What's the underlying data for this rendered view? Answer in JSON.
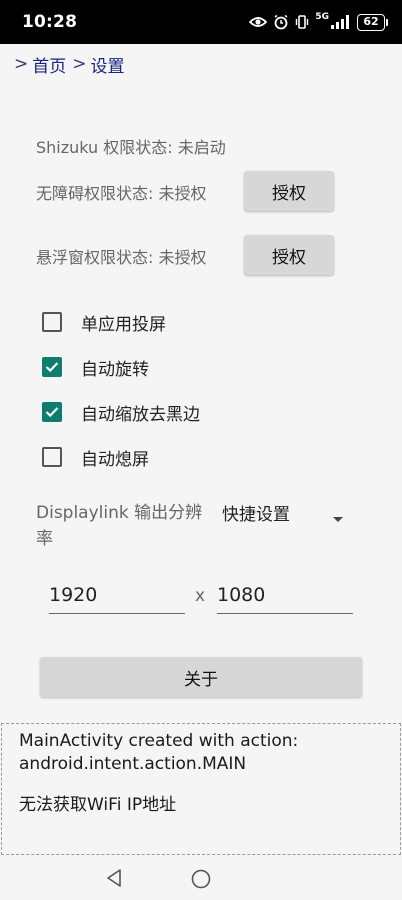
{
  "status_bar": {
    "time": "10:28",
    "network": "5G",
    "battery": "62",
    "icons": [
      "eye-icon",
      "alarm-icon",
      "vibrate-icon",
      "signal-icon",
      "battery-icon"
    ]
  },
  "breadcrumb": {
    "separator": ">",
    "home": "首页",
    "current": "设置"
  },
  "permissions": {
    "shizuku": "Shizuku 权限状态: 未启动",
    "accessibility": "无障碍权限状态: 未授权",
    "accessibility_button": "授权",
    "overlay": "悬浮窗权限状态: 未授权",
    "overlay_button": "授权"
  },
  "options": [
    {
      "label": "单应用投屏",
      "checked": false
    },
    {
      "label": "自动旋转",
      "checked": true
    },
    {
      "label": "自动缩放去黑边",
      "checked": true
    },
    {
      "label": "自动熄屏",
      "checked": false
    }
  ],
  "displaylink": {
    "label": "Displaylink 输出分辨率",
    "spinner_value": "快捷设置",
    "width": "1920",
    "separator": "x",
    "height": "1080"
  },
  "about_button": "关于",
  "log": {
    "line1": "MainActivity created with action:",
    "line2": "android.intent.action.MAIN",
    "line3": "无法获取WiFi IP地址"
  },
  "colors": {
    "accent": "#0f7d6e",
    "link": "#1a237e",
    "button": "#d6d7d6"
  }
}
